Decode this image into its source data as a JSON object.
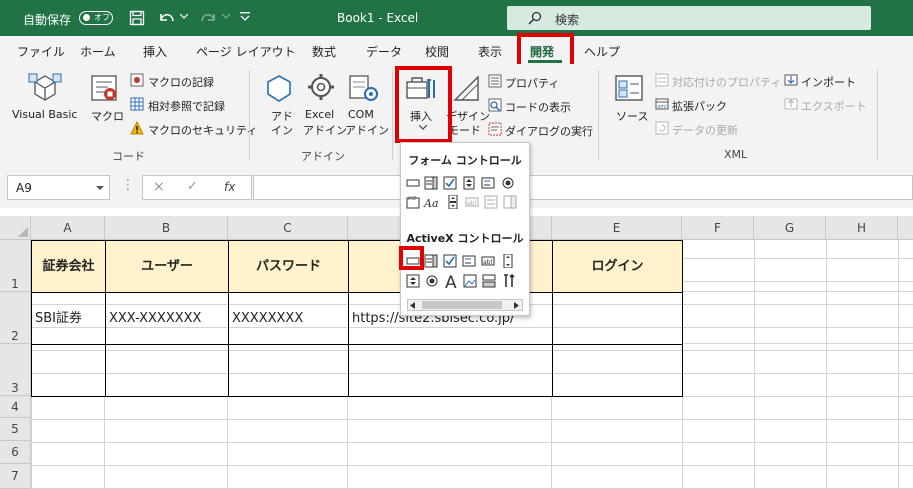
{
  "titlebar": {
    "autosave_label": "自動保存",
    "autosave_state": "オフ",
    "doc_title": "Book1  -  Excel",
    "search_placeholder": "検索"
  },
  "tabs": [
    "ファイル",
    "ホーム",
    "挿入",
    "ページ レイアウト",
    "数式",
    "データ",
    "校閲",
    "表示",
    "開発",
    "ヘルプ"
  ],
  "active_tab": "開発",
  "ribbon": {
    "code": {
      "visual_basic": "Visual Basic",
      "macro": "マクロ",
      "record_macro": "マクロの記録",
      "relative_ref": "相対参照で記録",
      "macro_security": "マクロのセキュリティ",
      "group": "コード"
    },
    "addins": {
      "addin_l1": "アド",
      "addin_l2": "イン",
      "excel_l1": "Excel",
      "excel_l2": "アドイン",
      "com_l1": "COM",
      "com_l2": "アドイン",
      "group": "アドイン"
    },
    "controls": {
      "insert": "挿入",
      "design_l1": "デザイン",
      "design_l2": "モード",
      "properties": "プロパティ",
      "view_code": "コードの表示",
      "run_dialog": "ダイアログの実行"
    },
    "xml": {
      "source": "ソース",
      "map_props": "対応付けのプロパティ",
      "expansion": "拡張パック",
      "refresh": "データの更新",
      "import": "インポート",
      "export": "エクスポート",
      "group": "XML"
    }
  },
  "formula_bar": {
    "name_box": "A9",
    "fx": "fx",
    "formula": ""
  },
  "dropdown": {
    "form_title": "フォーム コントロール",
    "activex_title": "ActiveX コントロール"
  },
  "sheet": {
    "columns": [
      "A",
      "B",
      "C",
      "D",
      "E",
      "F",
      "G",
      "H"
    ],
    "rows": [
      "1",
      "2",
      "3",
      "4",
      "5",
      "6",
      "7"
    ],
    "headers": [
      "証券会社",
      "ユーザー",
      "パスワード",
      "",
      "ログイン"
    ],
    "row2": [
      "SBI証券",
      "XXX-XXXXXXX",
      "XXXXXXXX",
      "https://site2.sbisec.co.jp/",
      ""
    ]
  },
  "colors": {
    "excel_green": "#217346",
    "highlight_red": "#e00000",
    "header_fill": "#fff2cc"
  }
}
